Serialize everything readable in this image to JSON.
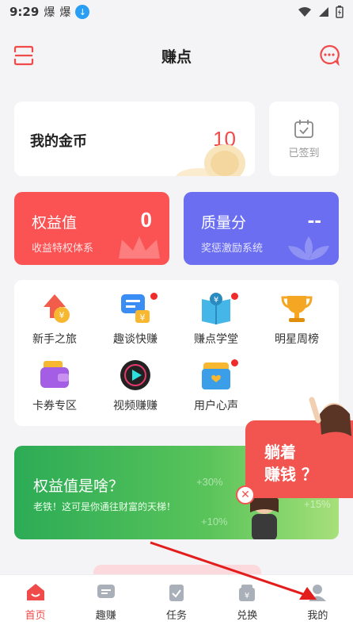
{
  "status_bar": {
    "time": "9:29",
    "notif_icons": [
      "爆",
      "爆"
    ]
  },
  "header": {
    "title": "赚点"
  },
  "coins": {
    "label": "我的金币",
    "value": "10"
  },
  "signin": {
    "label": "已签到"
  },
  "rights": {
    "name": "权益值",
    "value": "0",
    "subtitle": "收益特权体系"
  },
  "quality": {
    "name": "质量分",
    "value": "--",
    "subtitle": "奖惩激励系统"
  },
  "grid": {
    "items": [
      {
        "label": "新手之旅",
        "icon": "newbie-icon",
        "dot": false
      },
      {
        "label": "趣谈快赚",
        "icon": "chat-earn-icon",
        "dot": true
      },
      {
        "label": "赚点学堂",
        "icon": "book-icon",
        "dot": true
      },
      {
        "label": "明星周榜",
        "icon": "trophy-icon",
        "dot": false
      },
      {
        "label": "卡券专区",
        "icon": "wallet-icon",
        "dot": false
      },
      {
        "label": "视频赚赚",
        "icon": "video-icon",
        "dot": false
      },
      {
        "label": "用户心声",
        "icon": "mailbox-icon",
        "dot": true
      }
    ]
  },
  "banner": {
    "title": "权益值是啥？",
    "subtitle": "老铁！这可是你通往财富的天梯！",
    "pct1": "+30%",
    "pct2": "+15%",
    "pct3": "+10%"
  },
  "float_promo": {
    "line1": "躺着",
    "line2": "赚钱 ？"
  },
  "tabs": [
    {
      "label": "首页",
      "icon": "home-icon",
      "active": true
    },
    {
      "label": "趣赚",
      "icon": "chat-icon",
      "active": false
    },
    {
      "label": "任务",
      "icon": "task-icon",
      "active": false
    },
    {
      "label": "兑换",
      "icon": "exchange-icon",
      "active": false
    },
    {
      "label": "我的",
      "icon": "profile-icon",
      "active": false
    }
  ],
  "colors": {
    "accent": "#f04a4a",
    "rights_bg": "#fb5353",
    "quality_bg": "#6b6ef0",
    "banner_green": "#2cab56"
  }
}
